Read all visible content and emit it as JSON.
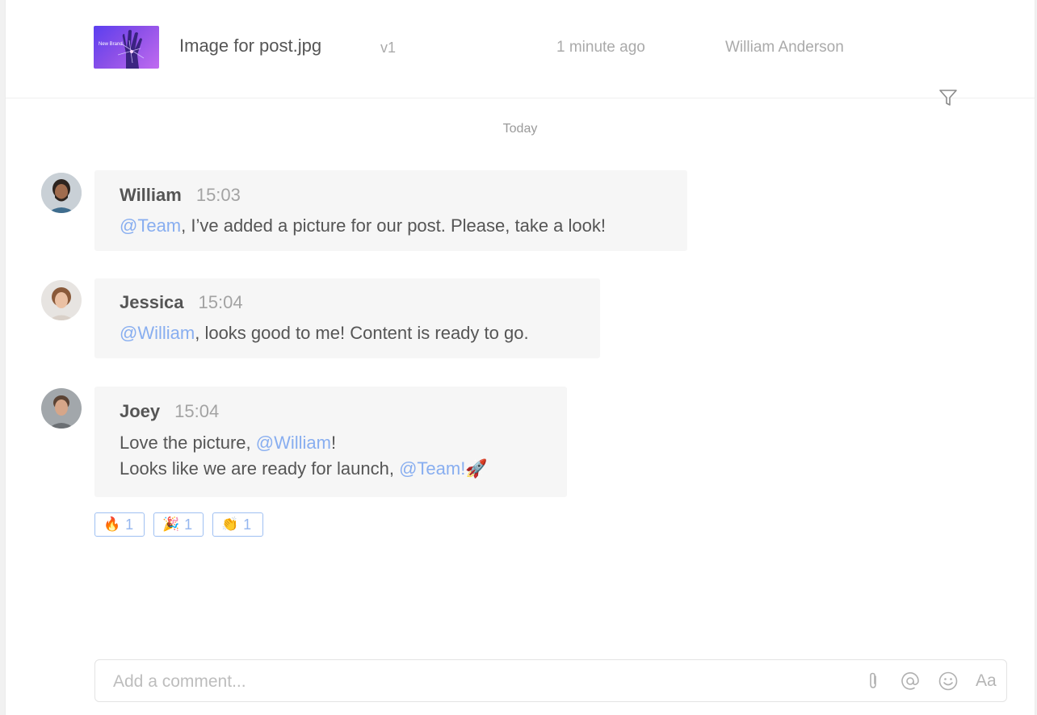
{
  "file": {
    "thumbnail_text": "New Brand",
    "name": "Image for post.jpg",
    "version": "v1",
    "time": "1 minute ago",
    "author": "William Anderson"
  },
  "day_divider": "Today",
  "messages": [
    {
      "author": "William",
      "time": "15:03",
      "lines": [
        [
          {
            "text": "@Team",
            "mention": true
          },
          {
            "text": ", I’ve added a picture for our post. Please, take a look!",
            "mention": false
          }
        ]
      ]
    },
    {
      "author": "Jessica",
      "time": "15:04",
      "lines": [
        [
          {
            "text": "@William",
            "mention": true
          },
          {
            "text": ", looks good to me! Content is ready to go.",
            "mention": false
          }
        ]
      ]
    },
    {
      "author": "Joey",
      "time": "15:04",
      "lines": [
        [
          {
            "text": "Love the picture, ",
            "mention": false
          },
          {
            "text": "@William",
            "mention": true
          },
          {
            "text": "!",
            "mention": false
          }
        ],
        [
          {
            "text": "Looks like we are ready for launch, ",
            "mention": false
          },
          {
            "text": "@Team!",
            "mention": true
          },
          {
            "text": "🚀",
            "mention": false
          }
        ]
      ]
    }
  ],
  "reactions": [
    {
      "emoji": "🔥",
      "count": "1"
    },
    {
      "emoji": "🎉",
      "count": "1"
    },
    {
      "emoji": "👏",
      "count": "1"
    }
  ],
  "composer": {
    "placeholder": "Add a comment...",
    "text_format_label": "Aa"
  },
  "colors": {
    "mention": "#88aef0",
    "reaction_border": "#9fc0f2"
  }
}
